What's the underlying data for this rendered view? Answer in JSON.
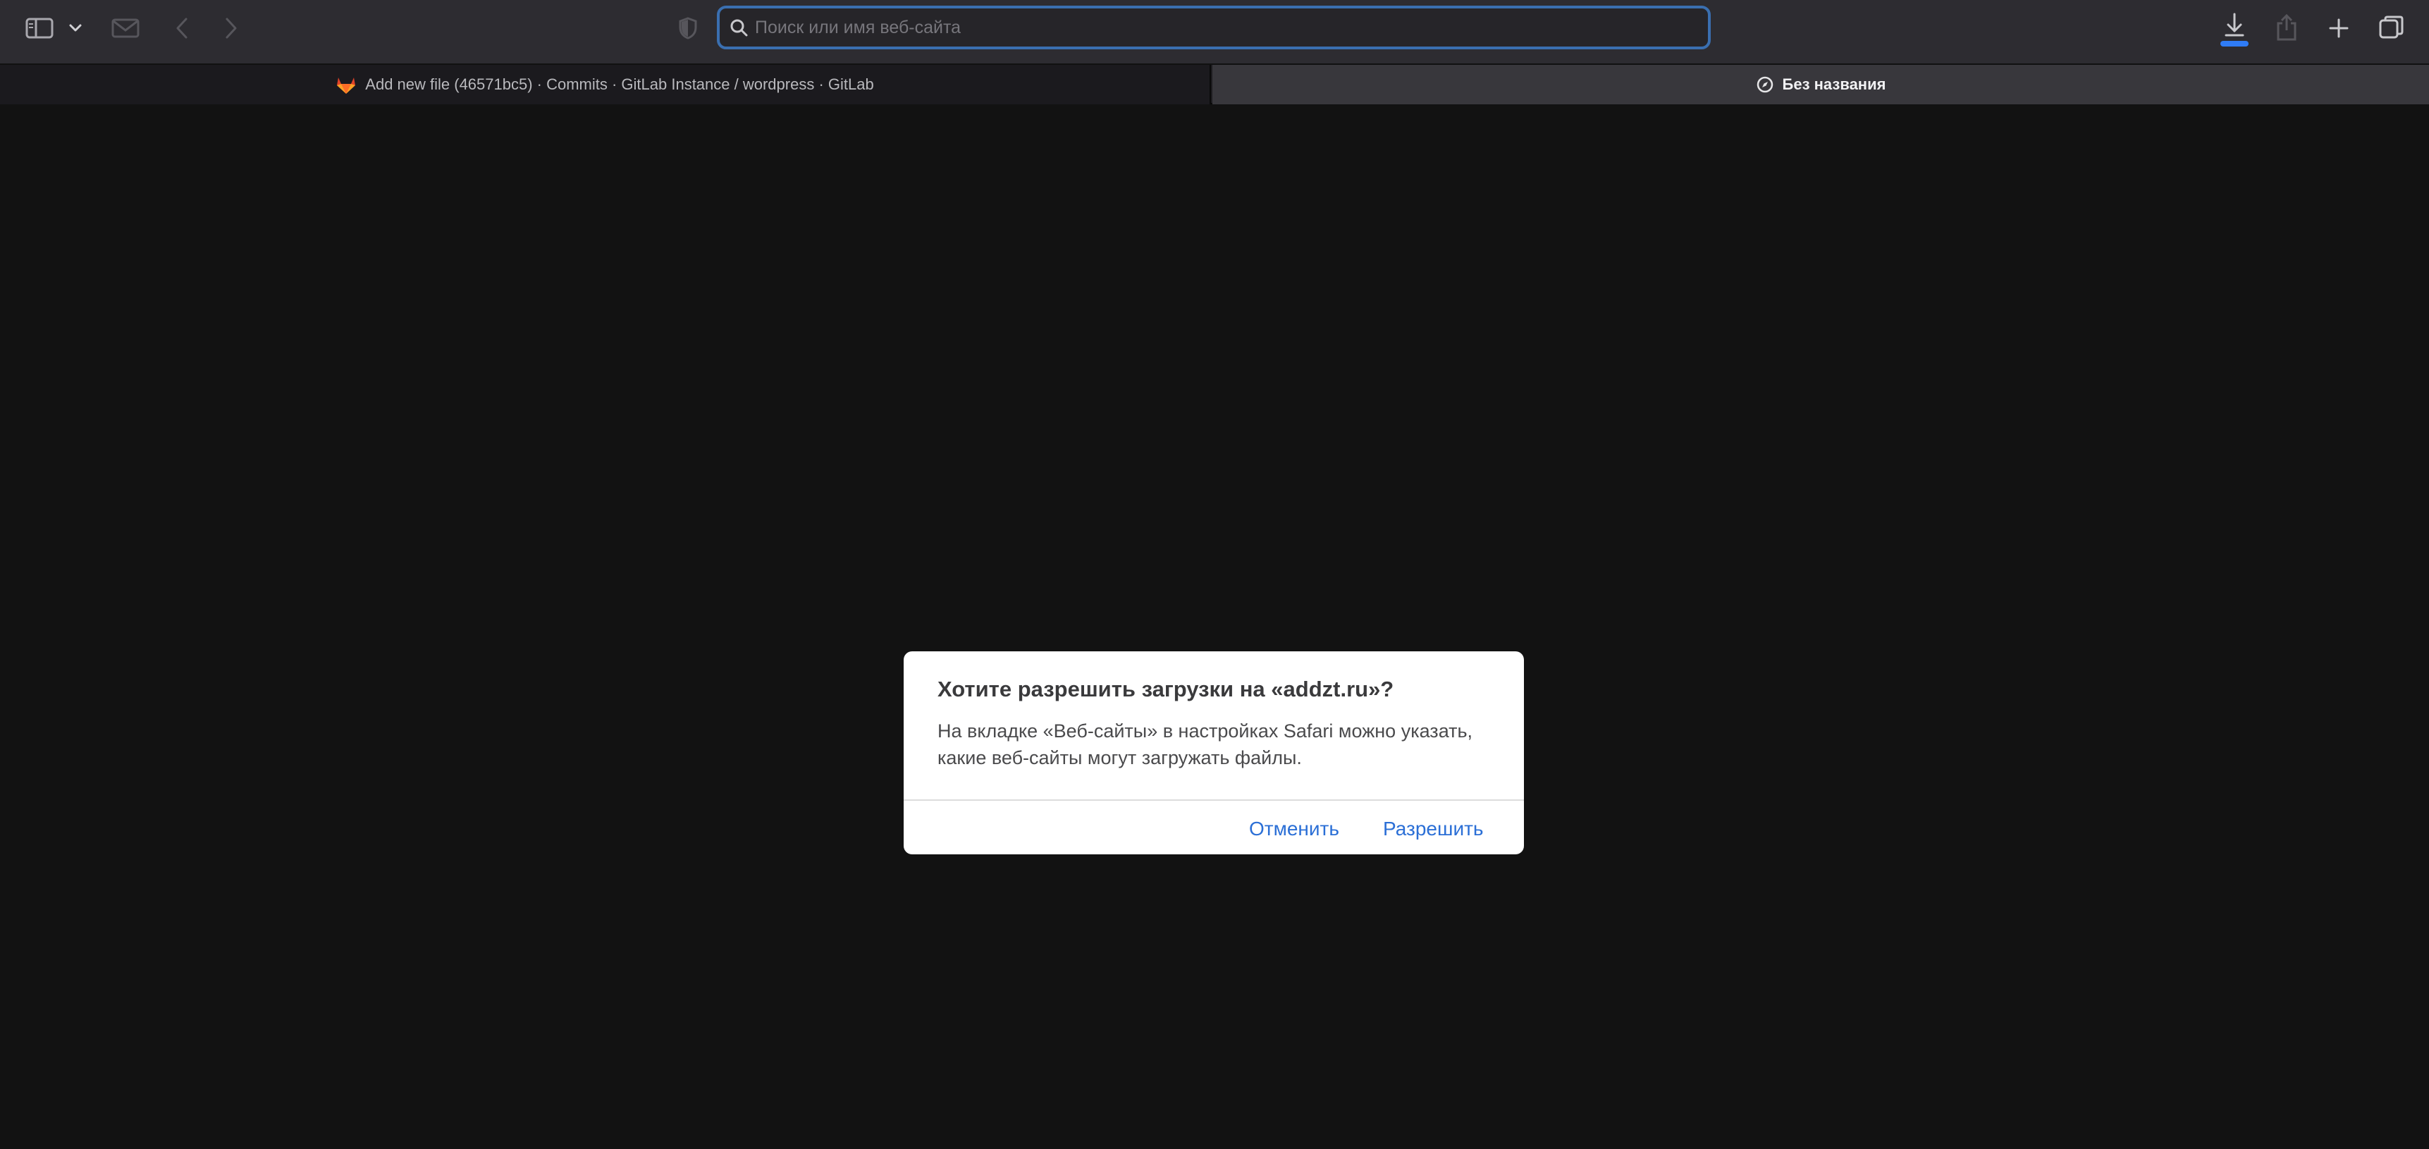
{
  "toolbar": {
    "address_placeholder": "Поиск или имя веб-сайта",
    "address_value": ""
  },
  "tabs": [
    {
      "title": "Add new file (46571bc5) · Commits · GitLab Instance / wordpress · GitLab",
      "active": false
    },
    {
      "title": "Без названия",
      "active": true
    }
  ],
  "dialog": {
    "title": "Хотите разрешить загрузки на «addzt.ru»?",
    "body": "На вкладке «Веб-сайты» в настройках Safari можно указать, какие веб-сайты могут загружать файлы.",
    "cancel_label": "Отменить",
    "allow_label": "Разрешить"
  },
  "colors": {
    "accent": "#2b6fd6",
    "focus_ring": "#3a6fb0",
    "download_progress": "#2f7cf6",
    "gitlab_orange": "#e24329"
  },
  "icons": {
    "sidebar": "sidebar-icon",
    "chevron": "chevron-down-icon",
    "mail": "mail-icon",
    "back": "back-arrow-icon",
    "forward": "forward-arrow-icon",
    "privacy": "shield-icon",
    "search": "search-icon",
    "downloads": "download-icon",
    "share": "share-icon",
    "new_tab": "plus-icon",
    "tab_overview": "tab-overview-icon",
    "gitlab": "gitlab-icon",
    "compass": "compass-icon"
  }
}
